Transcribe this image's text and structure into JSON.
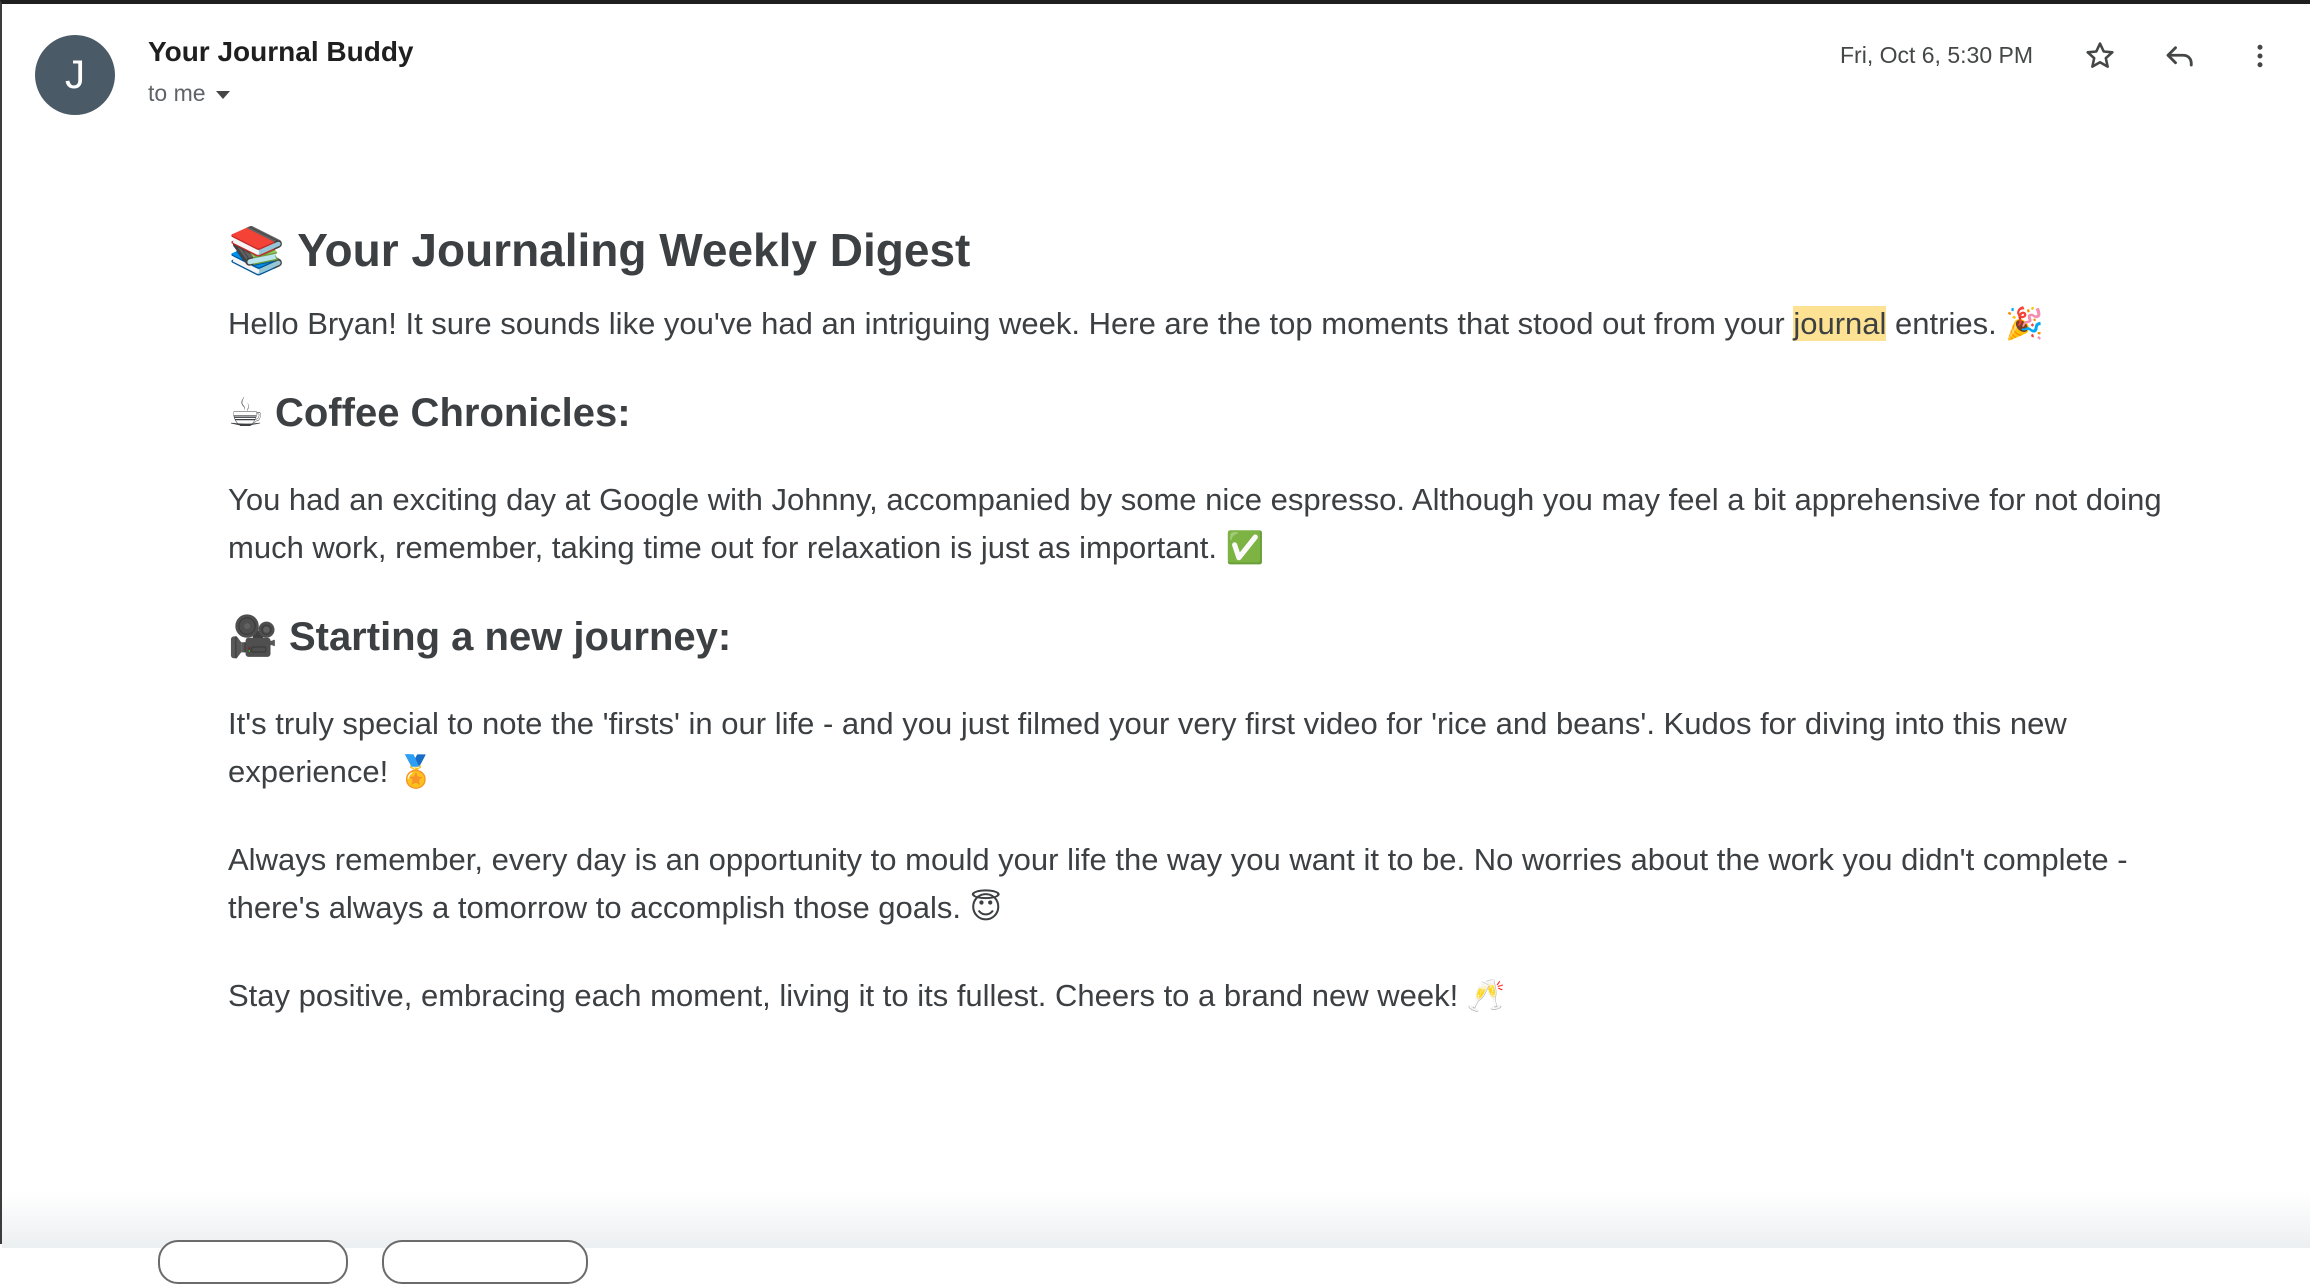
{
  "header": {
    "avatar_letter": "J",
    "sender": "Your Journal Buddy",
    "to": "to me",
    "date": "Fri, Oct 6, 5:30 PM",
    "icons": [
      "avatar",
      "chevron-down-icon",
      "star-icon",
      "reply-icon",
      "more-vert-icon"
    ]
  },
  "email": {
    "title_emoji": "📚",
    "title": "Your Journaling Weekly Digest",
    "greeting_before": "Hello Bryan! It sure sounds like you've had an intriguing week. Here are the top moments that stood out from your ",
    "greeting_highlight": "journal",
    "greeting_after": " entries. ",
    "greeting_emoji": "🎉",
    "section1_emoji": "☕",
    "section1_title": "Coffee Chronicles:",
    "section1_body": "You had an exciting day at Google with Johnny, accompanied by some nice espresso. Although you may feel a bit apprehensive for not doing much work, remember, taking time out for relaxation is just as important. ",
    "section1_emoji_end": "✅",
    "section2_emoji": "🎥",
    "section2_title": "Starting a new journey:",
    "section2_body": "It's truly special to note the 'firsts' in our life - and you just filmed your very first video for 'rice and beans'. Kudos for diving into this new experience! ",
    "section2_emoji_end": "🏅",
    "para3": "Always remember, every day is an opportunity to mould your life the way you want it to be. No worries about the work you didn't complete - there's always a tomorrow to accomplish those goals. ",
    "para3_emoji": "😇",
    "para4": "Stay positive, embracing each moment, living it to its fullest. Cheers to a brand new week! ",
    "para4_emoji": "🥂"
  },
  "colors": {
    "avatar_bg": "#4a5a66",
    "highlight": "#fde293",
    "text": "#3c4043"
  }
}
